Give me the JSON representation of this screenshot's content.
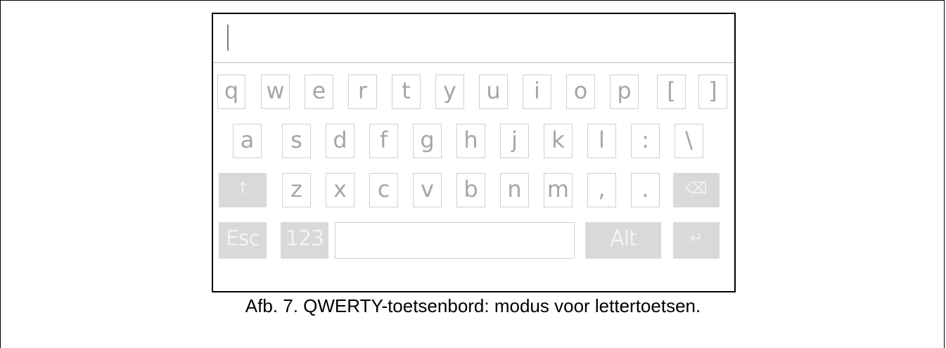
{
  "input": {
    "value": ""
  },
  "keyboard": {
    "row1": [
      "q",
      "w",
      "e",
      "r",
      "t",
      "y",
      "u",
      "i",
      "o",
      "p",
      "[",
      "]"
    ],
    "row2": [
      "a",
      "s",
      "d",
      "f",
      "g",
      "h",
      "j",
      "k",
      "l",
      ":",
      "\\"
    ],
    "row3": [
      "z",
      "x",
      "c",
      "v",
      "b",
      "n",
      "m",
      ",",
      "."
    ],
    "shift_glyph": "↑",
    "backspace_glyph": "⌫",
    "esc_label": "Esc",
    "numeric_label": "123",
    "alt_label": "Alt",
    "enter_glyph": "↵"
  },
  "caption": "Afb. 7. QWERTY-toetsenbord: modus voor lettertoetsen.",
  "colors": {
    "key_border": "#cfcfcf",
    "key_text": "#a6a6a6",
    "special_key_bg": "#d9d9d9",
    "special_key_text": "#f2f2f2"
  }
}
